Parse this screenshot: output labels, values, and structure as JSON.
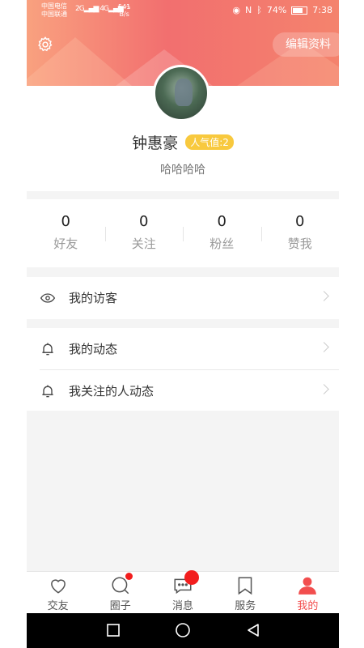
{
  "status_bar": {
    "carrier_1": "中国电信",
    "carrier_2": "中国联通",
    "net_1": "2G",
    "net_2": "4G",
    "speed": "541",
    "speed_unit": "B/s",
    "battery": "74%",
    "time": "7:38"
  },
  "header": {
    "edit_profile_label": "编辑资料"
  },
  "profile": {
    "name": "钟惠豪",
    "popularity": "人气值:2",
    "signature": "哈哈哈哈"
  },
  "stats": [
    {
      "value": "0",
      "label": "好友"
    },
    {
      "value": "0",
      "label": "关注"
    },
    {
      "value": "0",
      "label": "粉丝"
    },
    {
      "value": "0",
      "label": "赞我"
    }
  ],
  "menu": {
    "visitors": "我的访客",
    "my_posts": "我的动态",
    "following_posts": "我关注的人动态"
  },
  "tabs": [
    {
      "label": "交友",
      "icon": "heart-icon"
    },
    {
      "label": "圈子",
      "icon": "search-circle-icon"
    },
    {
      "label": "消息",
      "icon": "message-icon"
    },
    {
      "label": "服务",
      "icon": "bookmark-icon"
    },
    {
      "label": "我的",
      "icon": "person-icon"
    }
  ],
  "colors": {
    "accent": "#f24e4e",
    "header_gradient_start": "#f9a17f",
    "header_gradient_end": "#f26f6f",
    "badge": "#f8c93e"
  }
}
